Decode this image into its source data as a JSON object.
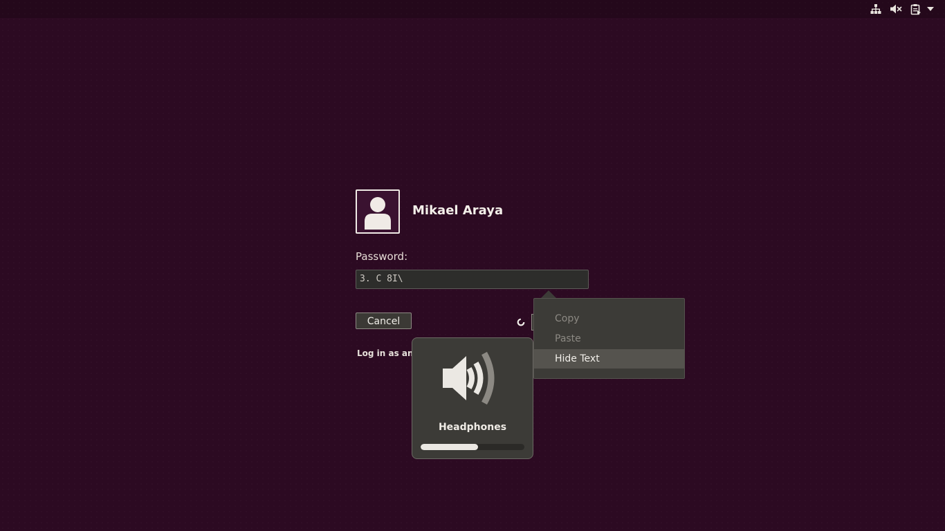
{
  "topbar": {
    "icons": [
      "network-icon",
      "volume-muted-icon",
      "clipboard-icon",
      "menu-arrow-icon"
    ]
  },
  "login": {
    "username": "Mikael Araya",
    "password_label": "Password:",
    "password_value": "3. C  8I\\",
    "cancel_label": "Cancel",
    "other_user_label": "Log in as ano"
  },
  "context_menu": {
    "items": [
      {
        "label": "Copy",
        "enabled": false
      },
      {
        "label": "Paste",
        "enabled": false
      },
      {
        "label": "Hide Text",
        "enabled": true,
        "highlighted": true
      }
    ]
  },
  "volume_osd": {
    "icon": "speaker-volume-icon",
    "label": "Headphones",
    "level": 0.55
  },
  "colors": {
    "background": "#2c0a22",
    "panel": "#3c3b37",
    "text": "#f2efea",
    "disabled_text": "#8c8983"
  }
}
